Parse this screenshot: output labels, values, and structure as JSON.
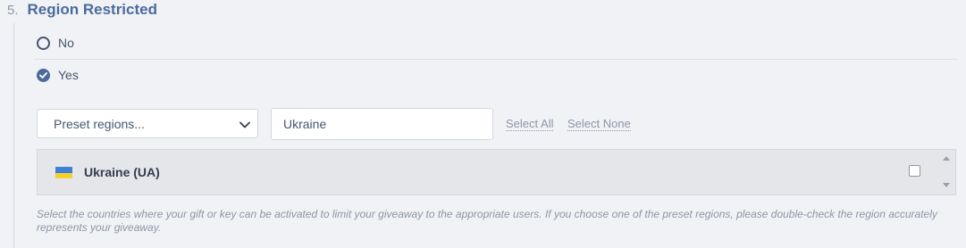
{
  "section": {
    "number": "5.",
    "title": "Region Restricted"
  },
  "options": [
    {
      "label": "No",
      "selected": false
    },
    {
      "label": "Yes",
      "selected": true
    }
  ],
  "preset_select": {
    "value": "Preset regions..."
  },
  "search": {
    "value": "Ukraine"
  },
  "actions": {
    "select_all": "Select All",
    "select_none": "Select None"
  },
  "regions": [
    {
      "name": "Ukraine (UA)",
      "checked": false,
      "flag": "ukraine-flag"
    }
  ],
  "help_text": "Select the countries where your gift or key can be activated to limit your giveaway to the appropriate users. If you choose one of the preset regions, please double-check the region accurately represents your giveaway.",
  "colors": {
    "accent": "#4b6b9c",
    "text": "#465670",
    "muted": "#8f96a6"
  }
}
